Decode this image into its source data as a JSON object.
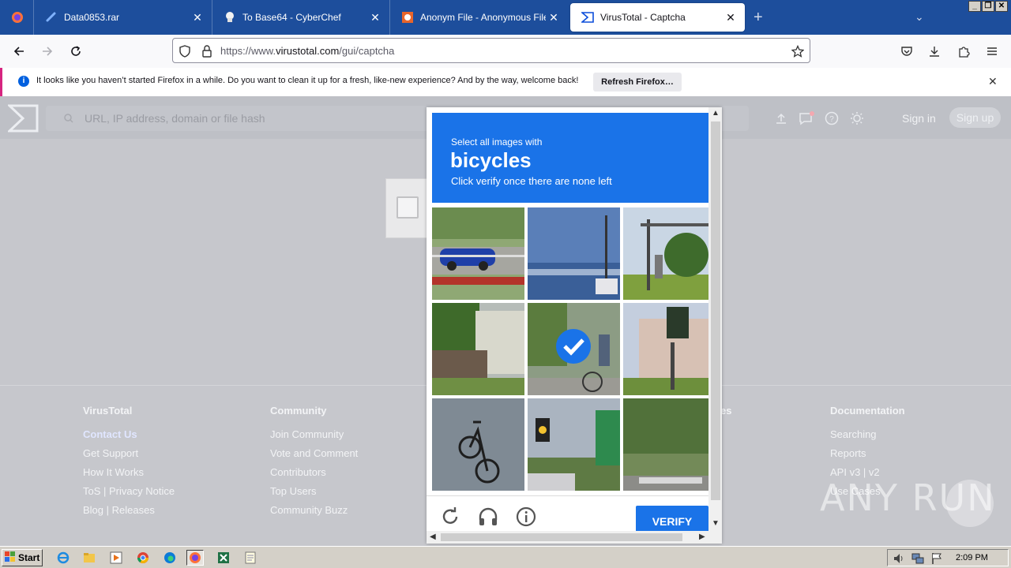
{
  "browser": {
    "tabs": [
      {
        "label": "Data0853.rar",
        "icon": "link-icon"
      },
      {
        "label": "To Base64 - CyberChef",
        "icon": "chef-hat-icon"
      },
      {
        "label": "Anonym File - Anonymous File Uplo",
        "icon": "anonym-file-icon"
      },
      {
        "label": "VirusTotal - Captcha",
        "icon": "virustotal-icon"
      }
    ],
    "url_prefix": "https://www.",
    "url_domain": "virustotal.com",
    "url_path": "/gui/captcha",
    "notification": {
      "text": "It looks like you haven’t started Firefox in a while. Do you want to clean it up for a fresh, like-new experience? And by the way, welcome back!",
      "button": "Refresh Firefox…"
    }
  },
  "vt": {
    "search_placeholder": "URL, IP address, domain or file hash",
    "sign_in": "Sign in",
    "sign_up": "Sign up",
    "footer": {
      "columns": [
        {
          "heading": "VirusTotal",
          "links": [
            "Contact Us",
            "Get Support",
            "How It Works",
            "ToS | Privacy Notice",
            "Blog | Releases"
          ]
        },
        {
          "heading": "Community",
          "links": [
            "Join Community",
            "Vote and Comment",
            "Contributors",
            "Top Users",
            "Community Buzz"
          ]
        },
        {
          "heading": "es",
          "links": []
        },
        {
          "heading": "Documentation",
          "links": [
            "Searching",
            "Reports",
            "API v3 | v2",
            "Use Cases"
          ]
        }
      ]
    }
  },
  "captcha": {
    "line1": "Select all images with",
    "keyword": "bicycles",
    "line3": "Click verify once there are none left",
    "verify_label": "VERIFY",
    "tiles_selected": [
      false,
      false,
      false,
      false,
      true,
      false,
      false,
      false,
      false
    ]
  },
  "watermark": "ANY RUN",
  "taskbar": {
    "start": "Start",
    "clock": "2:09 PM"
  },
  "colors": {
    "tabbar": "#1d4e9c",
    "captcha_blue": "#1a73e8",
    "notice_accent": "#d62580"
  }
}
